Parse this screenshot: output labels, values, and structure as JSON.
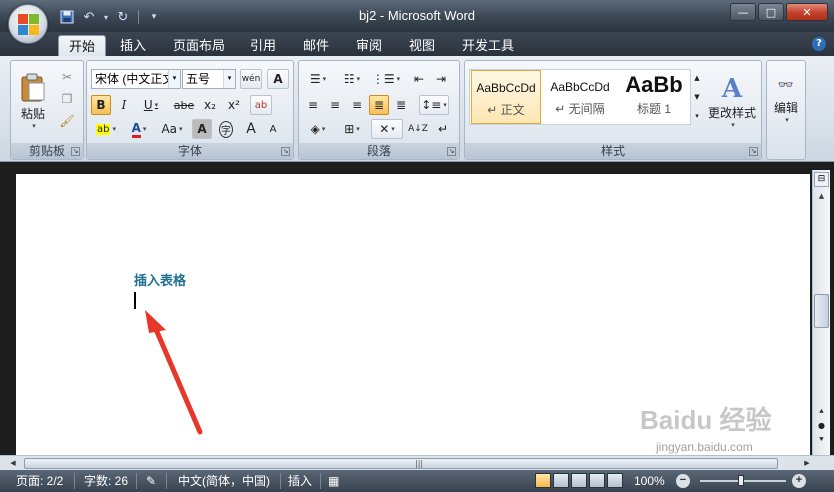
{
  "window": {
    "title": "bj2 - Microsoft Word",
    "controls": {
      "minimize": "—",
      "maximize": "□",
      "close": "✕"
    }
  },
  "qat": {
    "save_icon": "save-icon",
    "undo_icon": "undo-icon",
    "redo_icon": "redo-icon",
    "more": "▾"
  },
  "tabs": [
    {
      "label": "开始",
      "active": true
    },
    {
      "label": "插入"
    },
    {
      "label": "页面布局"
    },
    {
      "label": "引用"
    },
    {
      "label": "邮件"
    },
    {
      "label": "审阅"
    },
    {
      "label": "视图"
    },
    {
      "label": "开发工具"
    }
  ],
  "help": "?",
  "ribbon": {
    "clipboard": {
      "label": "剪贴板",
      "paste": "粘贴"
    },
    "font": {
      "label": "字体",
      "font_name": "宋体 (中文正文)",
      "font_size": "五号",
      "bold": "B",
      "italic": "I",
      "underline": "U",
      "strike": "abe",
      "subscript": "x₂",
      "superscript": "x²",
      "grow": "A",
      "shrink": "A",
      "case": "Aa",
      "char_shading": "A",
      "enclose": "字",
      "phonetic": "wén",
      "clear": "A"
    },
    "paragraph": {
      "label": "段落"
    },
    "styles": {
      "label": "样式",
      "items": [
        {
          "sample": "AaBbCcDd",
          "name": "↵ 正文"
        },
        {
          "sample": "AaBbCcDd",
          "name": "↵ 无间隔"
        },
        {
          "sample": "AaBb",
          "name": "标题 1"
        }
      ],
      "change_styles": "更改样式"
    },
    "editing": {
      "label": "编辑"
    }
  },
  "document": {
    "heading": "插入表格"
  },
  "status": {
    "page": "页面: 2/2",
    "words": "字数: 26",
    "language": "中文(简体，中国)",
    "mode": "插入",
    "zoom": "100%"
  },
  "watermark": {
    "logo": "Baidu 经验",
    "url": "jingyan.baidu.com"
  },
  "colors": {
    "heading": "#1f6f8f",
    "arrow": "#e8362b",
    "title_bar": "#3b4654"
  }
}
